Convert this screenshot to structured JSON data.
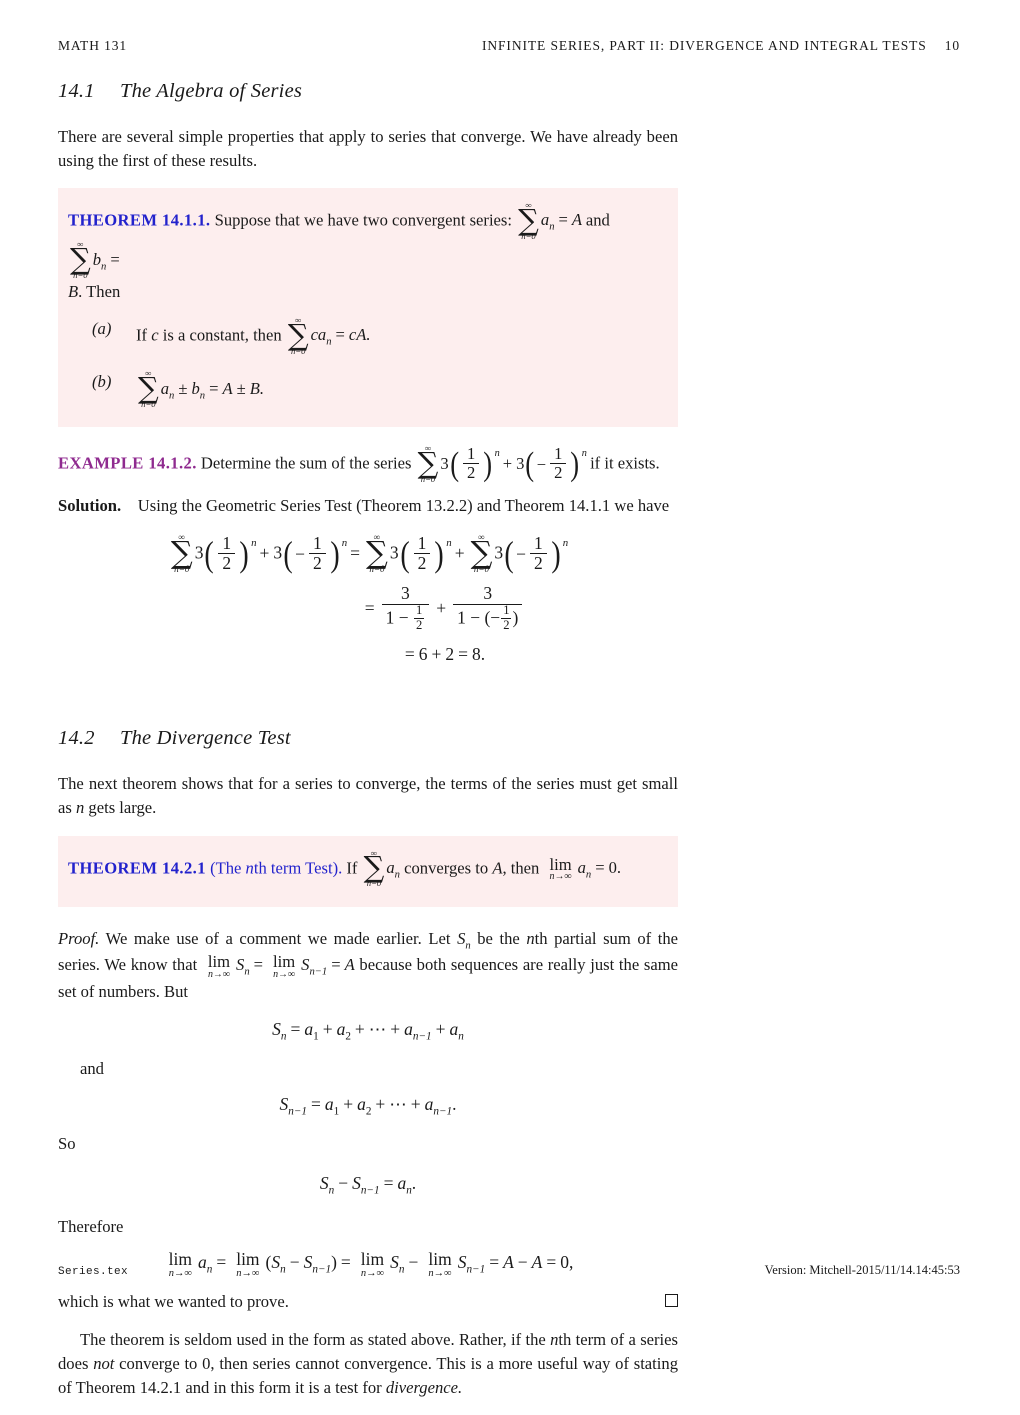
{
  "page": {
    "running_head_left": "MATH 131",
    "running_head_right": "INFINITE SERIES, PART II: DIVERGENCE AND INTEGRAL TESTS",
    "page_number": "10",
    "footer_left": "Series.tex",
    "footer_right": "Version: Mitchell-2015/11/14.14:45:53",
    "accent_theorem_color": "#2222cc",
    "accent_example_color": "#8f2a8f",
    "box_background_color": "#fdeeee"
  },
  "section_141": {
    "number": "14.1",
    "title": "The Algebra of Series",
    "intro": "There are several simple properties that apply to series that converge. We have already been using the first of these results."
  },
  "theorem_1411": {
    "label": "THEOREM 14.1.1.",
    "label_name": "THEOREM",
    "label_number": "14.1.1.",
    "statement_lead": "Suppose that we have two convergent series:",
    "series_a": "a",
    "series_a_sum": "A",
    "conj": "and",
    "series_b": "b",
    "series_b_sum": "B",
    "sum_upper": "∞",
    "sum_lower": "n=0",
    "then_text": "Then",
    "items": [
      {
        "tag": "(a)",
        "text_before": "If c is a constant, then",
        "lead": "If",
        "var": "c",
        "mid": "is a constant, then",
        "expr": "ca_n = cA."
      },
      {
        "tag": "(b)",
        "expr": "a_n ± b_n = A ± B."
      }
    ]
  },
  "example_1412": {
    "label": "EXAMPLE 14.1.2.",
    "label_name": "EXAMPLE",
    "label_number": "14.1.2.",
    "text_before": "Determine the sum of the series",
    "text_after": "if it exists.",
    "coefficient": "3",
    "ratio_1_num": "1",
    "ratio_1_den": "2",
    "ratio_2_num": "1",
    "ratio_2_den": "2",
    "exponent": "n",
    "solution_label": "Solution.",
    "solution_text": "Using the Geometric Series Test (Theorem 13.2.2) and Theorem 14.1.1 we have",
    "result_line": "= 6 + 2 = 8.",
    "result_first": "6",
    "result_second": "2",
    "result_total": "8"
  },
  "section_142": {
    "number": "14.2",
    "title": "The Divergence Test",
    "intro": "The next theorem shows that for a series to converge, the terms of the series must get small as n gets large."
  },
  "theorem_1421": {
    "label": "THEOREM 14.2.1",
    "label_name": "THEOREM",
    "label_number": "14.2.1",
    "paren": "(The nth term Test).",
    "statement_if": "If",
    "statement_mid": "converges to A, then",
    "limit_value": "0.",
    "sum_upper": "∞",
    "sum_lower": "n=0",
    "term": "a",
    "limit_sub": "n→∞"
  },
  "proof": {
    "label": "Proof.",
    "para_1": "We make use of a comment we made earlier. Let S_n be the nth partial sum of the series. We know that lim S_n = lim S_{n-1} = A because both sequences are really just the same set of numbers. But",
    "p1_a": "We make use of a comment we made earlier. Let",
    "p1_b": "be the",
    "p1_c": "th partial sum of the series. We know that",
    "p1_d": "because both sequences are really just the same set of numbers. But",
    "eq_sn": "S_n = a_1 + a_2 + ⋯ + a_{n-1} + a_n",
    "and_text": "and",
    "eq_sn1": "S_{n-1} = a_1 + a_2 + ⋯ + a_{n-1}.",
    "so_text": "So",
    "eq_diff": "S_n − S_{n-1} = a_n.",
    "therefore_text": "Therefore",
    "eq_final": "lim a_n = lim (S_n − S_{n-1}) = lim S_n − lim S_{n-1} = A − A = 0,",
    "closing": "which is what we wanted to prove.",
    "qed": "□"
  },
  "closing_para": {
    "text": "The theorem is seldom used in the form as stated above. Rather, if the nth term of a series does not converge to 0, then series cannot convergence. This is a more useful way of stating of Theorem 14.2.1 and in this form it is a test for divergence.",
    "t1": "The theorem is seldom used in the form as stated above. Rather, if the",
    "t2": "th term of a series does",
    "em_not": "not",
    "t3": "converge to 0, then series cannot convergence. This is a more useful way of stating of Theorem 14.2.1 and in this form it is a test for",
    "em_div": "divergence."
  },
  "symbols": {
    "infinity": "∞",
    "sigma": "∑",
    "lim": "lim",
    "n_to_inf": "n→∞",
    "plus_minus": "±",
    "minus": "−",
    "cdots": "⋯",
    "lower_limit": "n=0",
    "equals": "=",
    "plus": "+"
  }
}
